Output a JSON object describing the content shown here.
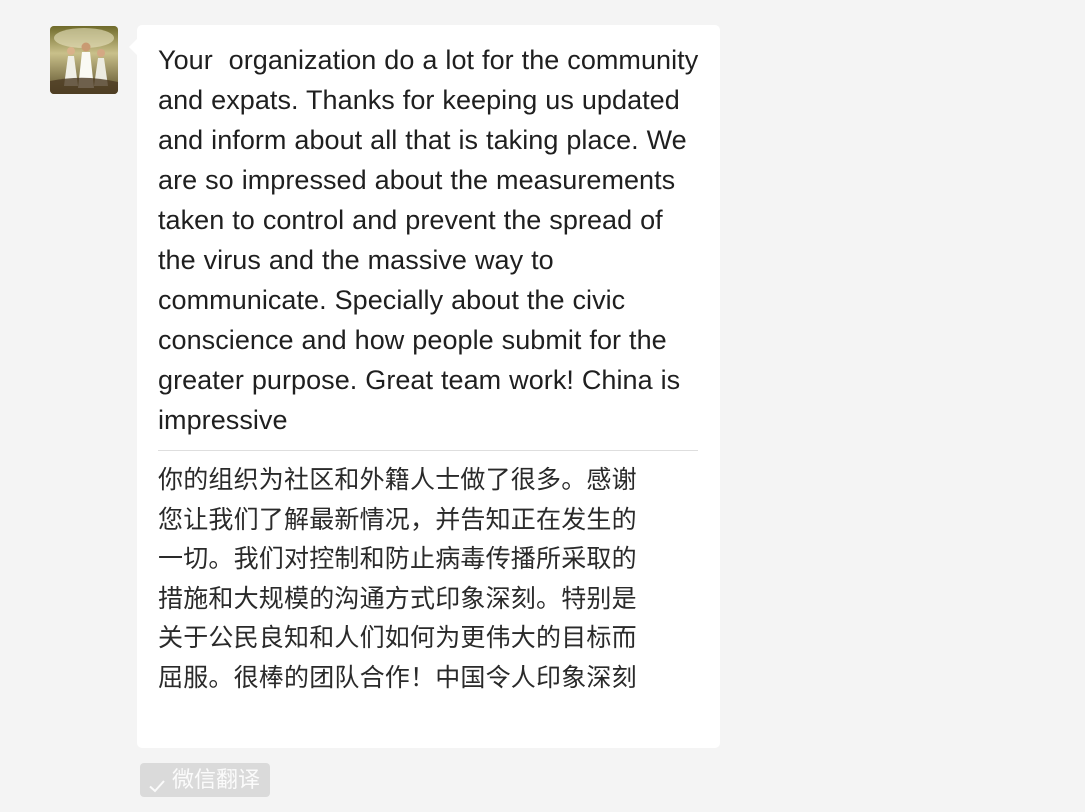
{
  "message": {
    "original_text": "Your  organization do a lot for the community and expats. Thanks for keeping us updated and inform about all that is taking place. We are so impressed about the measurements taken to control and prevent the spread of the virus and the massive way to communicate. Specially about the civic conscience and how people submit for the greater purpose. Great team work! China is impressive",
    "translated_lines": [
      "你的组织为社区和外籍人士做了很多。感谢",
      "您让我们了解最新情况，并告知正在发生的",
      "一切。我们对控制和防止病毒传播所采取的",
      "措施和大规模的沟通方式印象深刻。特别是",
      "关于公民良知和人们如何为更伟大的目标而",
      "屈服。很棒的团队合作！中国令人印象深刻"
    ]
  },
  "translate_tag": {
    "label": "微信翻译",
    "icon": "check-icon"
  },
  "colors": {
    "background": "#f4f4f4",
    "bubble": "#ffffff",
    "tag_background": "#dadada",
    "text": "#1f1f1f"
  }
}
